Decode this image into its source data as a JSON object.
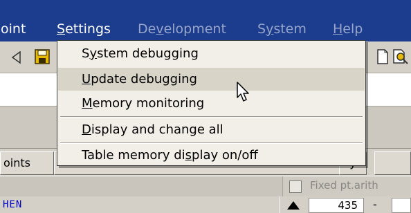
{
  "menubar": {
    "items": [
      {
        "pre": "",
        "ul": "",
        "post": "oint",
        "color": "#ffffff"
      },
      {
        "pre": "",
        "ul": "S",
        "post": "ettings",
        "color": "#ffffff"
      },
      {
        "pre": "De",
        "ul": "v",
        "post": "elopment",
        "color": "#97a6c9"
      },
      {
        "pre": "S",
        "ul": "y",
        "post": "stem",
        "color": "#97a6c9"
      },
      {
        "pre": "",
        "ul": "H",
        "post": "elp",
        "color": "#97a6c9"
      }
    ]
  },
  "toolbar": {
    "icons": [
      "back-arrow-icon",
      "save-icon",
      "page-icon",
      "find-icon"
    ]
  },
  "dropdown": {
    "items": [
      {
        "pre": "S",
        "ul": "y",
        "post": "stem debugging",
        "highlighted": false
      },
      {
        "pre": "",
        "ul": "U",
        "post": "pdate debugging",
        "highlighted": true
      },
      {
        "pre": "",
        "ul": "M",
        "post": "emory monitoring",
        "highlighted": false
      },
      {
        "pre": "",
        "ul": "D",
        "post": "isplay and change all",
        "highlighted": false
      },
      {
        "pre": "Table memory di",
        "ul": "s",
        "post": "play on/off",
        "highlighted": false
      }
    ]
  },
  "tabs": {
    "left_label": "oints",
    "right_fragment": "y"
  },
  "row2": {
    "checkbox_label": "Fixed pt.arith"
  },
  "row3": {
    "code_text": "HEN",
    "number_value": "435",
    "dash": "-"
  },
  "colors": {
    "menubar_bg": "#1c3c8e",
    "menu_active_text": "#ffffff",
    "menu_disabled_text": "#97a6c9",
    "code_text": "#0000c8"
  }
}
